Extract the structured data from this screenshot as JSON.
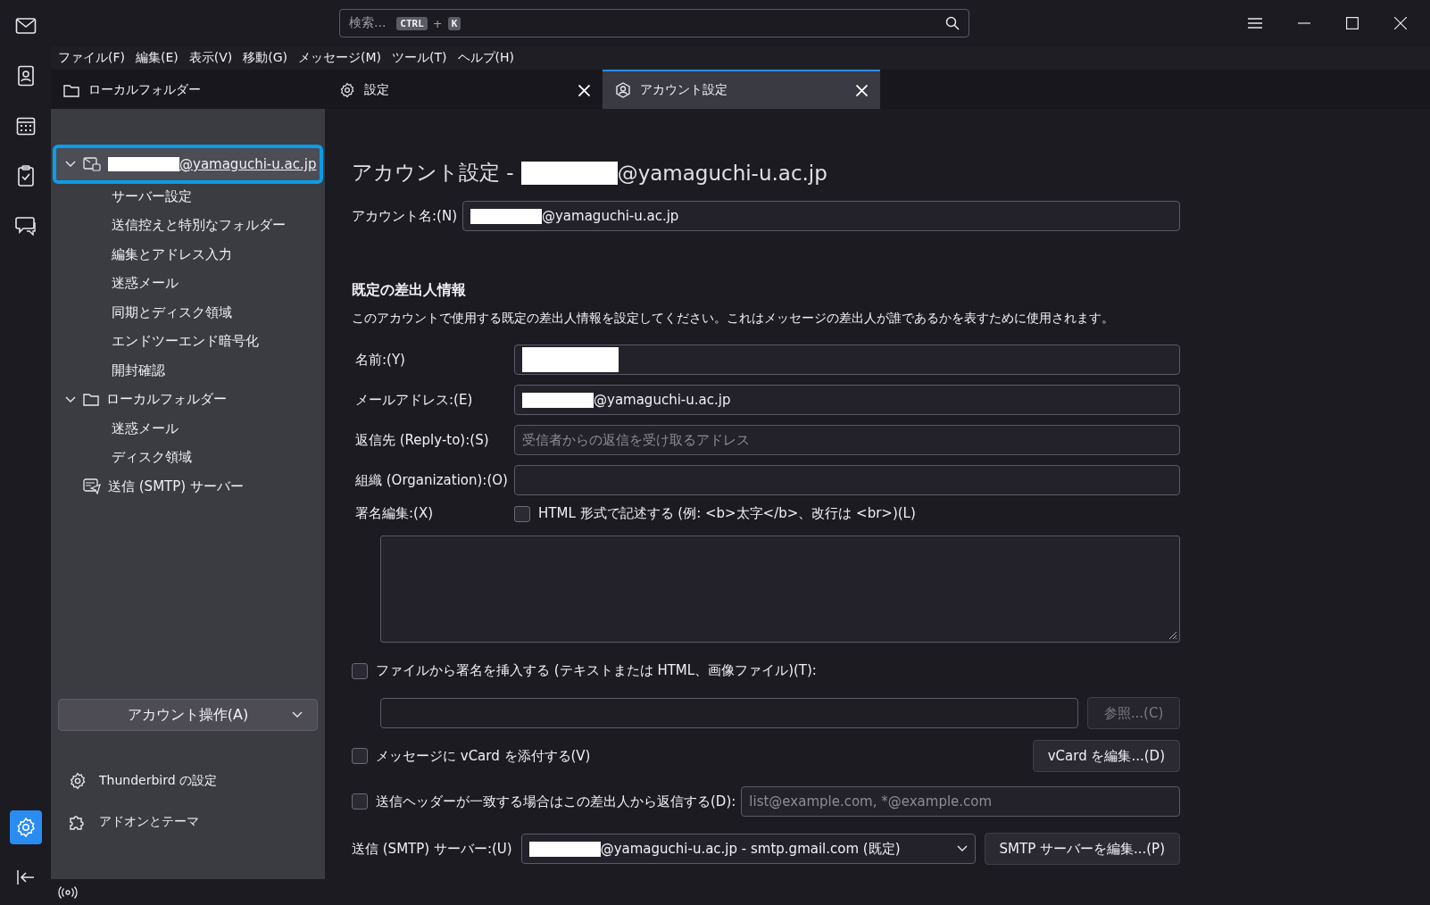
{
  "app_rail": [
    {
      "kind": "mail",
      "selected": false
    },
    {
      "kind": "address-book",
      "selected": false
    },
    {
      "kind": "calendar",
      "selected": false
    },
    {
      "kind": "tasks",
      "selected": false
    },
    {
      "kind": "chat",
      "selected": false
    },
    {
      "kind": "settings",
      "selected": true
    }
  ],
  "search": {
    "placeholder": "検索...",
    "keys": [
      "CTRL",
      "K"
    ],
    "joiner": "+"
  },
  "menu_bar": [
    "ファイル(F)",
    "編集(E)",
    "表示(V)",
    "移動(G)",
    "メッセージ(M)",
    "ツール(T)",
    "ヘルプ(H)"
  ],
  "tabs": [
    {
      "kind": "folder",
      "label": "ローカルフォルダー",
      "closable": false,
      "selected": false
    },
    {
      "kind": "gear",
      "label": "設定",
      "closable": true,
      "selected": false
    },
    {
      "kind": "account",
      "label": "アカウント設定",
      "closable": true,
      "selected": true
    }
  ],
  "account_tree": [
    {
      "kind": "account",
      "label": "@yamaguchi-u.ac.jp",
      "redacted": true,
      "expanded": true,
      "selected": true,
      "children": [
        {
          "label": "サーバー設定",
          "selected": false
        },
        {
          "label": "送信控えと特別なフォルダー",
          "selected": false
        },
        {
          "label": "編集とアドレス入力",
          "selected": false
        },
        {
          "label": "迷惑メール",
          "selected": false
        },
        {
          "label": "同期とディスク領域",
          "selected": false
        },
        {
          "label": "エンドツーエンド暗号化",
          "selected": false
        },
        {
          "label": "開封確認",
          "selected": false
        }
      ]
    },
    {
      "kind": "folder",
      "label": "ローカルフォルダー",
      "redacted": false,
      "expanded": true,
      "selected": false,
      "children": [
        {
          "label": "迷惑メール",
          "selected": false
        },
        {
          "label": "ディスク領域",
          "selected": false
        }
      ]
    },
    {
      "kind": "smtp",
      "label": "送信 (SMTP) サーバー",
      "redacted": false,
      "selected": false
    }
  ],
  "account_actions": {
    "label": "アカウント操作(A)"
  },
  "sidebar_links": [
    {
      "kind": "gear",
      "label": "Thunderbird の設定"
    },
    {
      "kind": "puzzle",
      "label": "アドオンとテーマ"
    }
  ],
  "page_title": {
    "prefix": "アカウント設定 -",
    "suffix": "@yamaguchi-u.ac.jp",
    "redacted": true
  },
  "account_name": {
    "label": "アカウント名:(N)",
    "value": "@yamaguchi-u.ac.jp",
    "redacted": true
  },
  "identity": {
    "heading": "既定の差出人情報",
    "description": "このアカウントで使用する既定の差出人情報を設定してください。これはメッセージの差出人が誰であるかを表すために使用されます。",
    "fields": [
      {
        "label": "名前:(Y)",
        "redacted": true
      },
      {
        "label": "メールアドレス:(E)",
        "value": "@yamaguchi-u.ac.jp",
        "redacted": true
      },
      {
        "label": "返信先 (Reply-to):(S)",
        "placeholder": "受信者からの返信を受け取るアドレス",
        "redacted": false
      },
      {
        "label": "組織 (Organization):(O)",
        "redacted": false
      }
    ]
  },
  "signature": {
    "label": "署名編集:(X)",
    "html_label": "HTML 形式で記述する (例: <b>太字</b>、改行は <br>)(L)",
    "html_checked": false
  },
  "file_signature": {
    "label": "ファイルから署名を挿入する (テキストまたは HTML、画像ファイル)(T):",
    "checked": false,
    "browse_label": "参照...(C)",
    "browse_disabled": true
  },
  "vcard": {
    "label": "メッセージに vCard を添付する(V)",
    "checked": false,
    "button": "vCard を編集...(D)"
  },
  "reply_from": {
    "label": "送信ヘッダーが一致する場合はこの差出人から返信する(D):",
    "checked": false,
    "placeholder": "list@example.com, *@example.com"
  },
  "smtp": {
    "label": "送信 (SMTP) サーバー:(U)",
    "value": "@yamaguchi-u.ac.jp - smtp.gmail.com (既定)",
    "redacted": true,
    "button": "SMTP サーバーを編集...(P)"
  }
}
